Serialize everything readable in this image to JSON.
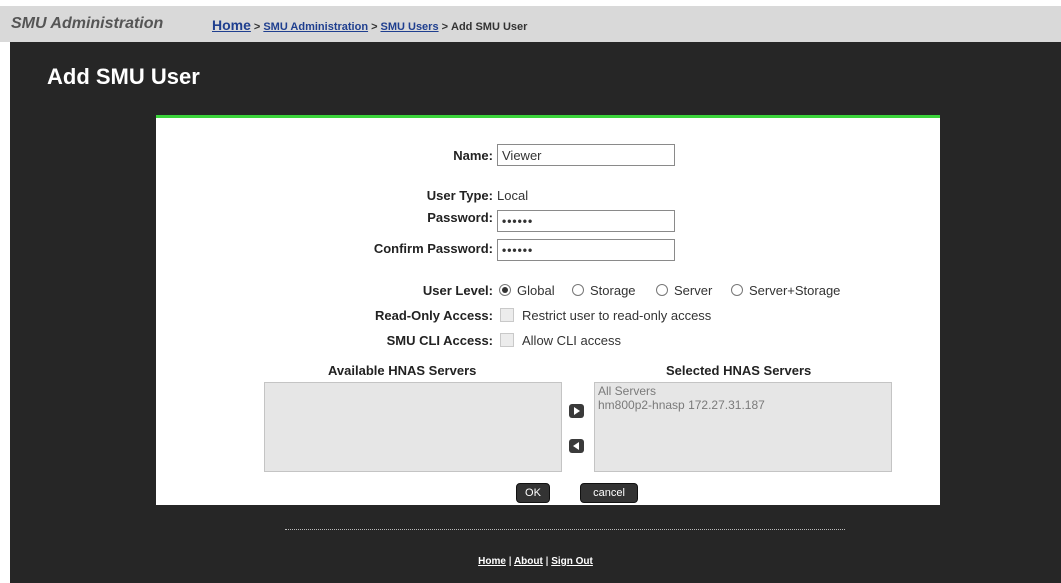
{
  "header": {
    "app_title": "SMU Administration",
    "breadcrumb": {
      "home": "Home",
      "sep": ">",
      "level1": "SMU Administration",
      "level2": "SMU Users",
      "current": "Add SMU User"
    }
  },
  "page_title": "Add SMU User",
  "form": {
    "name_label": "Name:",
    "name_value": "Viewer",
    "user_type_label": "User Type:",
    "user_type_value": "Local",
    "password_label": "Password:",
    "password_value": "••••••",
    "confirm_password_label": "Confirm Password:",
    "confirm_password_value": "••••••",
    "user_level_label": "User Level:",
    "user_level_options": [
      "Global",
      "Storage",
      "Server",
      "Server+Storage"
    ],
    "user_level_selected": "Global",
    "read_only_label": "Read-Only Access:",
    "read_only_text": "Restrict user to read-only access",
    "cli_label": "SMU CLI Access:",
    "cli_text": "Allow CLI access",
    "available_header": "Available HNAS Servers",
    "selected_header": "Selected HNAS Servers",
    "available_servers": [],
    "selected_servers": [
      "All Servers",
      "hm800p2-hnasp 172.27.31.187"
    ],
    "ok_label": "OK",
    "cancel_label": "cancel"
  },
  "footer": {
    "home": "Home",
    "about": "About",
    "sign_out": "Sign Out",
    "sep": "|"
  },
  "colors": {
    "accent_green": "#3bd43b",
    "main_bg": "#262626",
    "link_blue": "#1f3f8f"
  },
  "icons": {
    "move_right": "triangle-right-icon",
    "move_left": "triangle-left-icon"
  }
}
